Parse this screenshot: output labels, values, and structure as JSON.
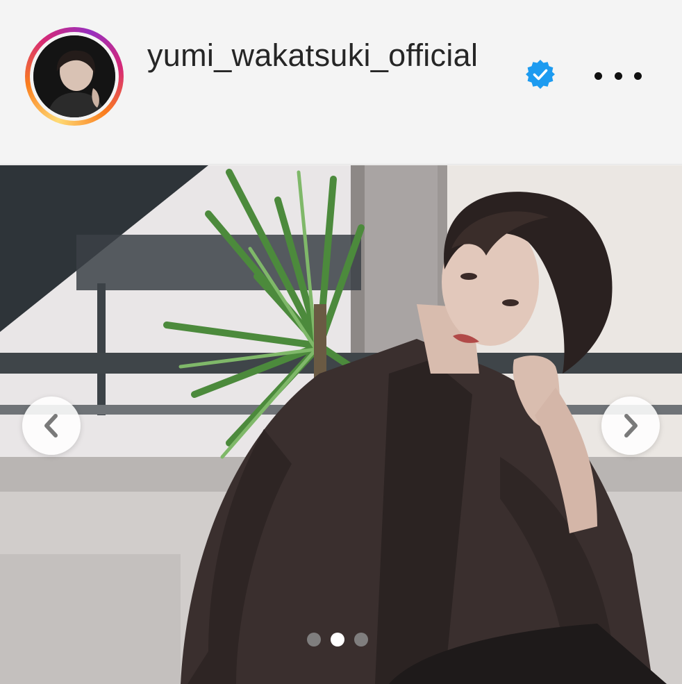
{
  "post": {
    "username": "yumi_wakatsuki_official",
    "verified": true,
    "verified_icon": "verified-badge-icon",
    "verified_color": "#1d9bf0",
    "more_icon": "more-options-icon",
    "avatar_ring_colors": [
      "#feda75",
      "#fa7e1e",
      "#d62976",
      "#962fbf"
    ]
  },
  "carousel": {
    "prev_icon": "chevron-left-icon",
    "next_icon": "chevron-right-icon",
    "slide_count": 3,
    "active_index": 1
  }
}
